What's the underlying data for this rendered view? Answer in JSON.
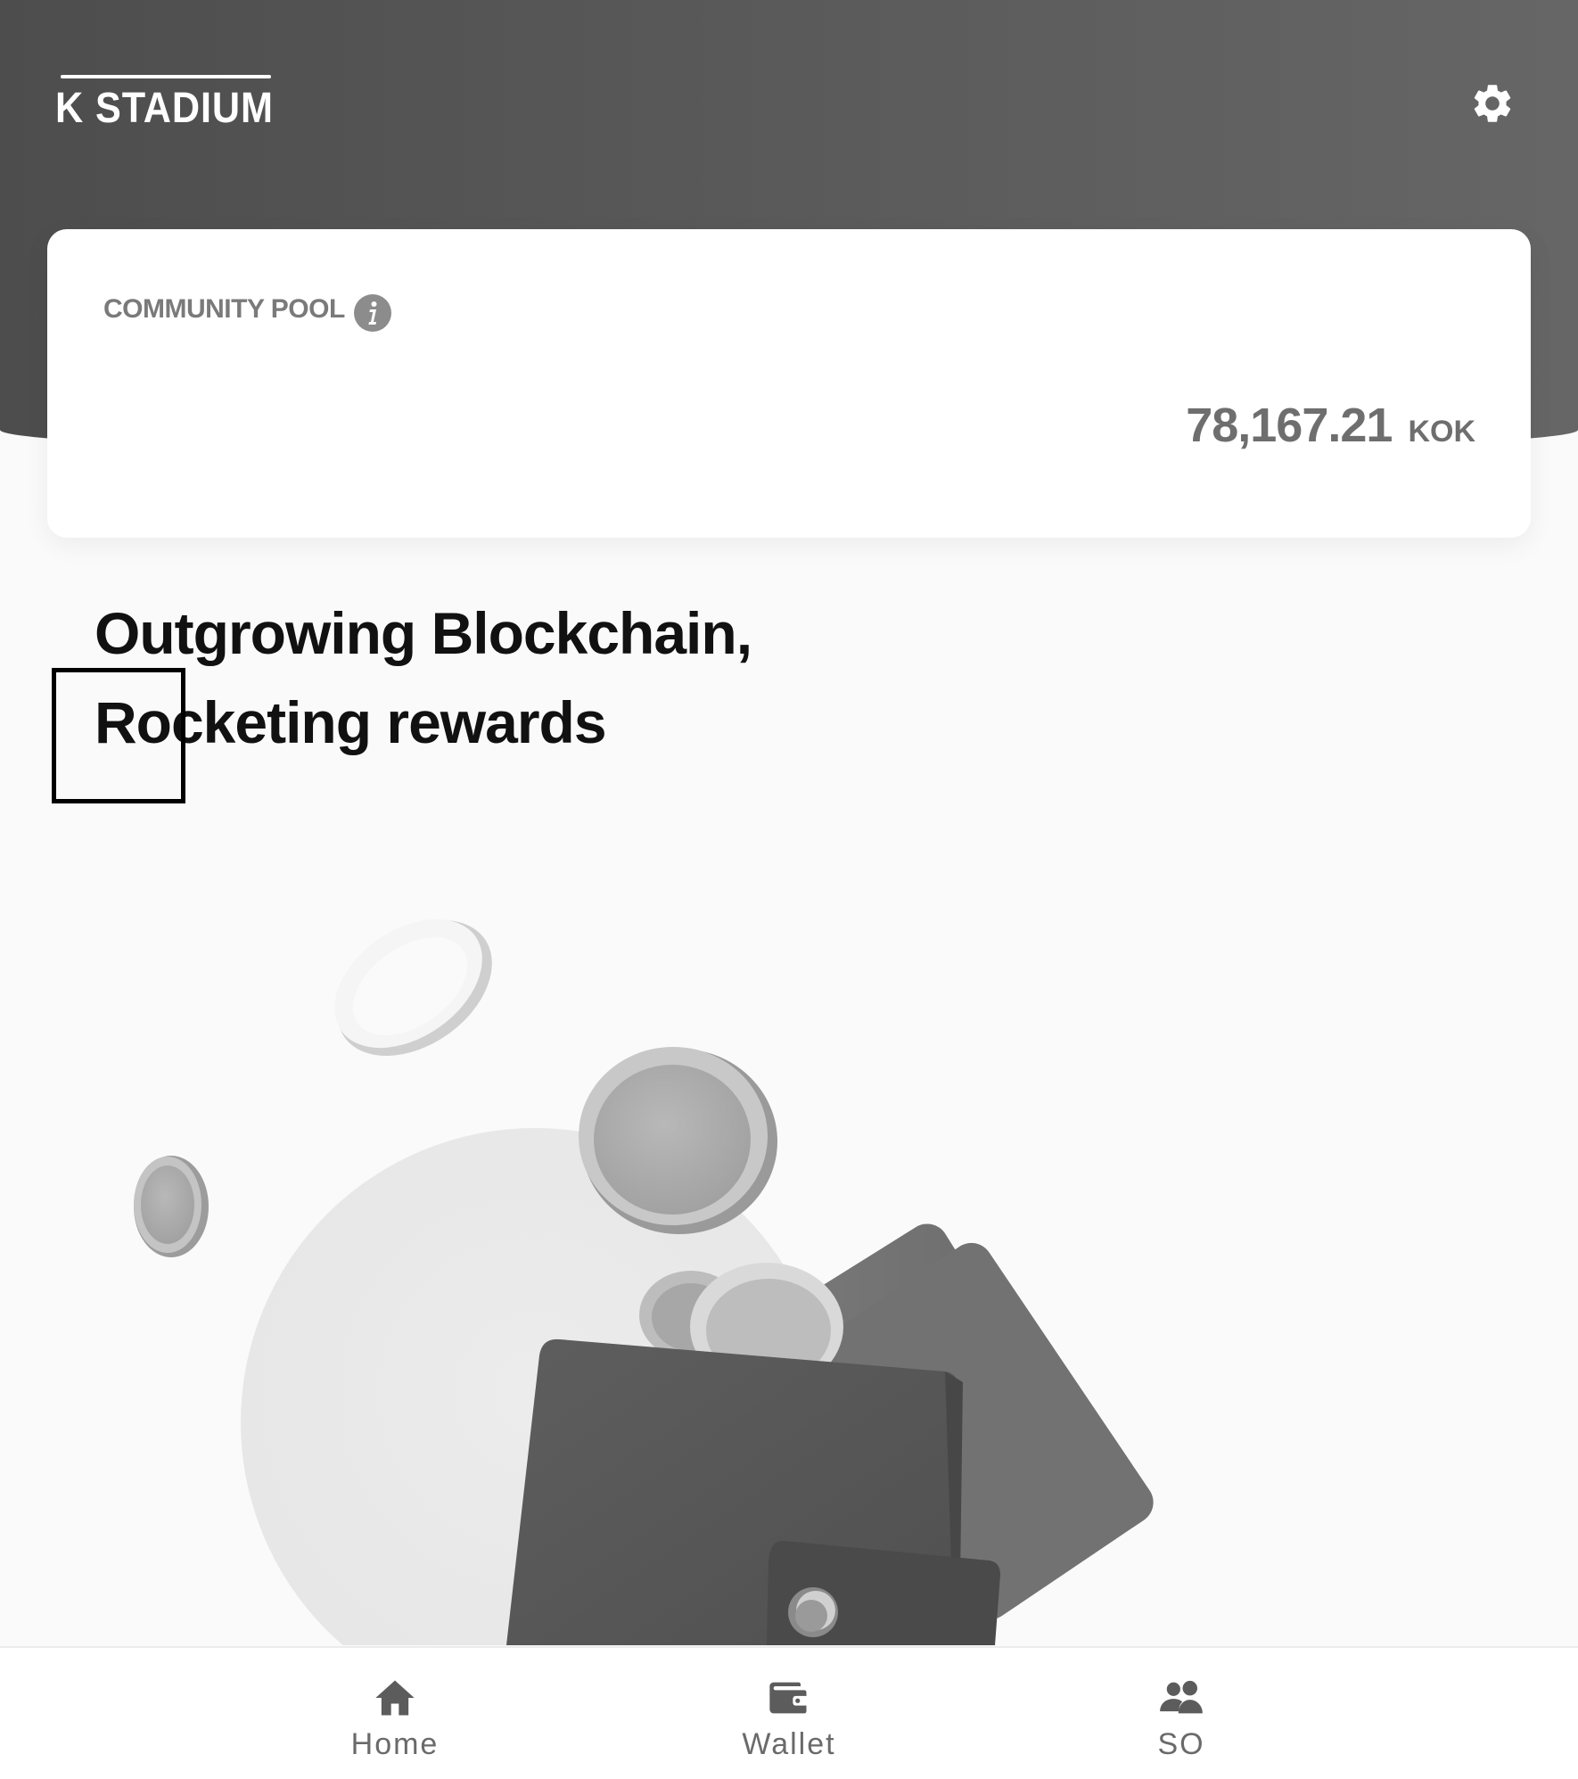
{
  "header": {
    "logo_text": "K STADIUM",
    "settings_icon": "gear-icon"
  },
  "community_pool": {
    "label": "COMMUNITY POOL",
    "info_icon": "info-icon",
    "amount": "78,167.21",
    "unit": "KOK"
  },
  "hero": {
    "line1": "Outgrowing Blockchain,",
    "line2": "Rocketing rewards"
  },
  "bottom_nav": {
    "items": [
      {
        "label": "Home",
        "icon": "home-icon"
      },
      {
        "label": "Wallet",
        "icon": "wallet-icon"
      },
      {
        "label": "SO",
        "icon": "users-icon"
      }
    ]
  },
  "colors": {
    "header": "#555555",
    "card": "#ffffff",
    "text_dark": "#111111",
    "text_muted": "#6e6e6e"
  }
}
